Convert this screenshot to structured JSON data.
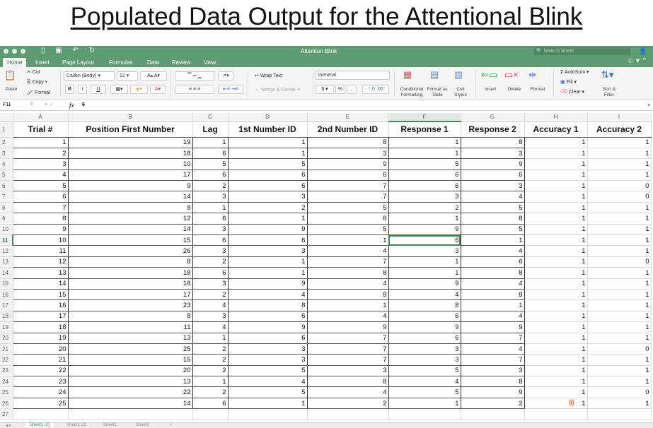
{
  "slide_title": "Populated Data Output for the Attentional Blink",
  "window": {
    "title": "Attention Blink",
    "search_placeholder": "Search Sheet"
  },
  "ribbon_tabs": [
    "Home",
    "Insert",
    "Page Layout",
    "Formulas",
    "Data",
    "Review",
    "View"
  ],
  "active_tab": "Home",
  "ribbon": {
    "paste": "Paste",
    "cut": "Cut",
    "copy": "Copy",
    "format_painter": "Format",
    "font": "Calibri (Body)",
    "font_size": "12",
    "bold": "B",
    "italic": "I",
    "underline": "U",
    "wrap_text": "Wrap Text",
    "merge_center": "Merge & Center",
    "number_format": "General",
    "currency": "$",
    "percent": "%",
    "comma": ",",
    "conditional_formatting": "Conditional Formatting",
    "format_as_table": "Format as Table",
    "cell_styles": "Cell Styles",
    "insert": "Insert",
    "delete": "Delete",
    "format": "Format",
    "autosum": "AutoSum",
    "fill": "Fill",
    "clear": "Clear",
    "sort_filter": "Sort & Filter"
  },
  "formula_bar": {
    "cell_ref": "F11",
    "fx": "fx",
    "value": "6"
  },
  "columns": [
    "A",
    "B",
    "C",
    "D",
    "E",
    "F",
    "G",
    "H",
    "I"
  ],
  "selected_column": "F",
  "selected_row": 11,
  "headers": [
    "Trial #",
    "Position First Number",
    "Lag",
    "1st Number ID",
    "2nd Number ID",
    "Response 1",
    "Response 2",
    "Accuracy 1",
    "Accuracy 2"
  ],
  "rows": [
    [
      1,
      19,
      1,
      1,
      8,
      1,
      8,
      1,
      1
    ],
    [
      2,
      18,
      6,
      1,
      3,
      1,
      3,
      1,
      1
    ],
    [
      3,
      10,
      5,
      5,
      9,
      5,
      9,
      1,
      1
    ],
    [
      4,
      17,
      6,
      6,
      6,
      6,
      6,
      1,
      1
    ],
    [
      5,
      9,
      2,
      6,
      7,
      6,
      3,
      1,
      0
    ],
    [
      6,
      14,
      3,
      3,
      7,
      3,
      4,
      1,
      0
    ],
    [
      7,
      8,
      1,
      2,
      5,
      2,
      5,
      1,
      1
    ],
    [
      8,
      12,
      6,
      1,
      8,
      1,
      8,
      1,
      1
    ],
    [
      9,
      14,
      3,
      9,
      5,
      9,
      5,
      1,
      1
    ],
    [
      10,
      15,
      6,
      6,
      1,
      6,
      1,
      1,
      1
    ],
    [
      11,
      26,
      3,
      3,
      4,
      3,
      4,
      1,
      1
    ],
    [
      12,
      8,
      2,
      1,
      7,
      1,
      6,
      1,
      0
    ],
    [
      13,
      18,
      6,
      1,
      8,
      1,
      8,
      1,
      1
    ],
    [
      14,
      18,
      3,
      9,
      4,
      9,
      4,
      1,
      1
    ],
    [
      15,
      17,
      2,
      4,
      8,
      4,
      8,
      1,
      1
    ],
    [
      16,
      23,
      4,
      8,
      1,
      8,
      1,
      1,
      1
    ],
    [
      17,
      8,
      3,
      6,
      4,
      6,
      4,
      1,
      1
    ],
    [
      18,
      11,
      4,
      9,
      9,
      9,
      9,
      1,
      1
    ],
    [
      19,
      13,
      1,
      6,
      7,
      6,
      7,
      1,
      1
    ],
    [
      20,
      25,
      2,
      3,
      7,
      3,
      4,
      1,
      0
    ],
    [
      21,
      15,
      2,
      3,
      7,
      3,
      7,
      1,
      1
    ],
    [
      22,
      20,
      2,
      5,
      3,
      5,
      3,
      1,
      1
    ],
    [
      23,
      13,
      1,
      4,
      8,
      4,
      8,
      1,
      1
    ],
    [
      24,
      22,
      2,
      5,
      4,
      5,
      9,
      1,
      0
    ],
    [
      25,
      14,
      6,
      1,
      2,
      1,
      2,
      1,
      1
    ]
  ],
  "sheet_tabs": [
    "Sheet1 (2)",
    "Sheet1 (3)",
    "Sheet1",
    "Sheet2"
  ],
  "add_sheet": "+"
}
